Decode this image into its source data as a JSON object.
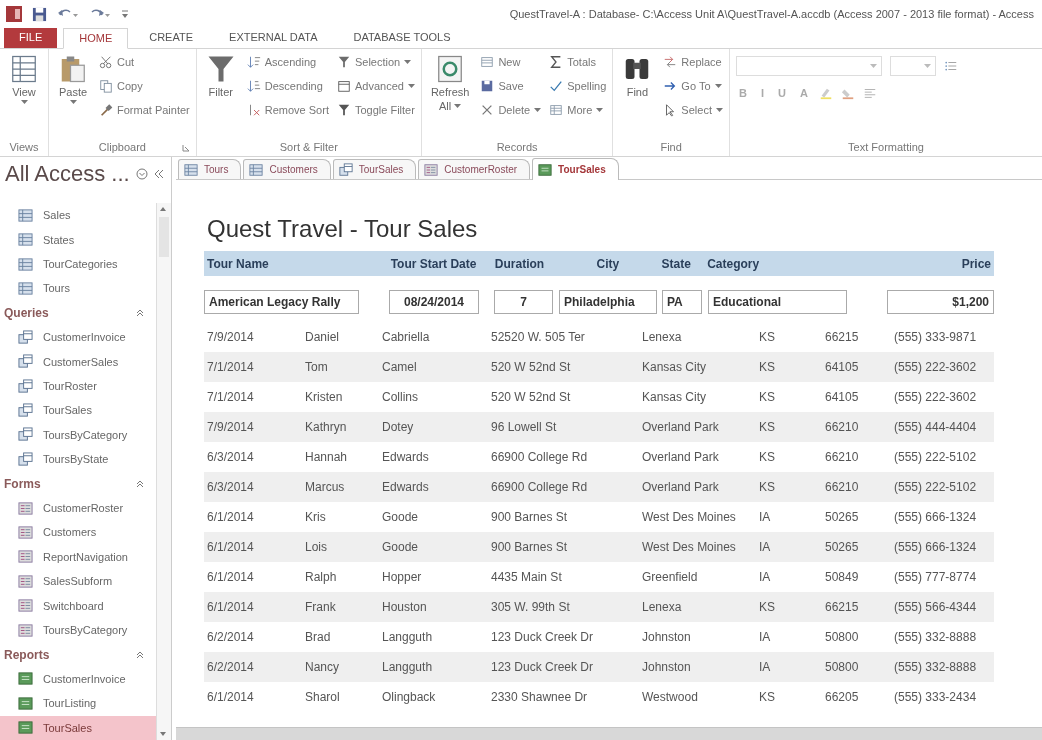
{
  "title_bar": {
    "title": "QuestTravel-A : Database- C:\\Access Unit A\\QuestTravel-A.accdb (Access 2007 - 2013 file format) - Access"
  },
  "ribbon": {
    "tabs": [
      {
        "label": "FILE",
        "kind": "file",
        "selected": false
      },
      {
        "label": "HOME",
        "kind": "tab",
        "selected": true
      },
      {
        "label": "CREATE",
        "kind": "tab",
        "selected": false
      },
      {
        "label": "EXTERNAL DATA",
        "kind": "tab",
        "selected": false
      },
      {
        "label": "DATABASE TOOLS",
        "kind": "tab",
        "selected": false
      }
    ],
    "groups": [
      {
        "label": "Views",
        "kind": "columns",
        "columns": [
          [
            {
              "label": "View",
              "kind": "large",
              "dropdown": true
            }
          ]
        ]
      },
      {
        "label": "Clipboard",
        "kind": "columns",
        "launcher": true,
        "columns": [
          [
            {
              "label": "Paste",
              "kind": "large",
              "dropdown": true
            }
          ],
          [
            {
              "label": "Cut",
              "kind": "small",
              "dropdown": false
            },
            {
              "label": "Copy",
              "kind": "small",
              "dropdown": false
            },
            {
              "label": "Format Painter",
              "kind": "small",
              "dropdown": false
            }
          ]
        ]
      },
      {
        "label": "Sort & Filter",
        "kind": "columns",
        "columns": [
          [
            {
              "label": "Filter",
              "kind": "large",
              "dropdown": false
            }
          ],
          [
            {
              "label": "Ascending",
              "kind": "small",
              "dropdown": false
            },
            {
              "label": "Descending",
              "kind": "small",
              "dropdown": false
            },
            {
              "label": "Remove Sort",
              "kind": "small",
              "dropdown": false
            }
          ],
          [
            {
              "label": "Selection",
              "kind": "small",
              "dropdown": true
            },
            {
              "label": "Advanced",
              "kind": "small",
              "dropdown": true
            },
            {
              "label": "Toggle Filter",
              "kind": "small",
              "dropdown": false
            }
          ]
        ]
      },
      {
        "label": "Records",
        "kind": "columns",
        "columns": [
          [
            {
              "label": "Refresh All",
              "kind": "large",
              "dropdown": true
            }
          ],
          [
            {
              "label": "New",
              "kind": "small",
              "dropdown": false
            },
            {
              "label": "Save",
              "kind": "small",
              "dropdown": false
            },
            {
              "label": "Delete",
              "kind": "small",
              "dropdown": true
            }
          ],
          [
            {
              "label": "Totals",
              "kind": "small",
              "dropdown": false
            },
            {
              "label": "Spelling",
              "kind": "small",
              "dropdown": false
            },
            {
              "label": "More",
              "kind": "small",
              "dropdown": true
            }
          ]
        ]
      },
      {
        "label": "Find",
        "kind": "columns",
        "columns": [
          [
            {
              "label": "Find",
              "kind": "large",
              "dropdown": false
            }
          ],
          [
            {
              "label": "Replace",
              "kind": "small",
              "dropdown": false
            },
            {
              "label": "Go To",
              "kind": "small",
              "dropdown": true
            },
            {
              "label": "Select",
              "kind": "small",
              "dropdown": true
            }
          ]
        ]
      },
      {
        "label": "Text Formatting",
        "kind": "rows",
        "rows": [
          [
            {
              "kind": "combo"
            },
            {
              "kind": "combo"
            },
            {
              "kind": "icon"
            }
          ],
          [
            {
              "kind": "letter",
              "label": "B"
            },
            {
              "kind": "letter",
              "label": "I"
            },
            {
              "kind": "letter",
              "label": "U"
            },
            {
              "kind": "letter",
              "label": "A"
            },
            {
              "kind": "icon"
            },
            {
              "kind": "icon"
            },
            {
              "kind": "icon"
            }
          ]
        ]
      }
    ]
  },
  "nav_pane": {
    "title": "All Access ...",
    "sections": [
      {
        "kind": "table",
        "items": [
          {
            "label": "Sales",
            "selected": false
          },
          {
            "label": "States",
            "selected": false
          },
          {
            "label": "TourCategories",
            "selected": false
          },
          {
            "label": "Tours",
            "selected": false
          }
        ]
      },
      {
        "kind": "query",
        "header": "Queries",
        "expanded": true,
        "items": [
          {
            "label": "CustomerInvoice",
            "selected": false
          },
          {
            "label": "CustomerSales",
            "selected": false
          },
          {
            "label": "TourRoster",
            "selected": false
          },
          {
            "label": "TourSales",
            "selected": false
          },
          {
            "label": "ToursByCategory",
            "selected": false
          },
          {
            "label": "ToursByState",
            "selected": false
          }
        ]
      },
      {
        "kind": "form",
        "header": "Forms",
        "expanded": true,
        "items": [
          {
            "label": "CustomerRoster",
            "selected": false
          },
          {
            "label": "Customers",
            "selected": false
          },
          {
            "label": "ReportNavigation",
            "selected": false
          },
          {
            "label": "SalesSubform",
            "selected": false
          },
          {
            "label": "Switchboard",
            "selected": false
          },
          {
            "label": "ToursByCategory",
            "selected": false
          }
        ]
      },
      {
        "kind": "report",
        "header": "Reports",
        "expanded": true,
        "items": [
          {
            "label": "CustomerInvoice",
            "selected": false
          },
          {
            "label": "TourListing",
            "selected": false
          },
          {
            "label": "TourSales",
            "selected": true
          }
        ]
      }
    ]
  },
  "document_tabs": [
    {
      "label": "Tours",
      "kind": "table",
      "selected": false
    },
    {
      "label": "Customers",
      "kind": "table",
      "selected": false
    },
    {
      "label": "TourSales",
      "kind": "query",
      "selected": false
    },
    {
      "label": "CustomerRoster",
      "kind": "form",
      "selected": false
    },
    {
      "label": "TourSales",
      "kind": "report",
      "selected": true
    }
  ],
  "report": {
    "title": "Quest Travel - Tour Sales",
    "tour_header": {
      "labels": [
        "Tour Name",
        "Tour Start Date",
        "Duration",
        "City",
        "State",
        "Category",
        "Price"
      ],
      "values": [
        "American Legacy Rally",
        "08/24/2014",
        "7",
        "Philadelphia",
        "PA",
        "Educational",
        "$1,200"
      ]
    },
    "detail_lines": [
      [
        "7/9/2014",
        "Daniel",
        "Cabriella",
        "52520 W. 505 Ter",
        "Lenexa",
        "KS",
        "66215",
        "(555) 333-9871"
      ],
      [
        "7/1/2014",
        "Tom",
        "Camel",
        "520 W 52nd St",
        "Kansas City",
        "KS",
        "64105",
        "(555) 222-3602"
      ],
      [
        "7/1/2014",
        "Kristen",
        "Collins",
        "520 W 52nd St",
        "Kansas City",
        "KS",
        "64105",
        "(555) 222-3602"
      ],
      [
        "7/9/2014",
        "Kathryn",
        "Dotey",
        "96 Lowell St",
        "Overland Park",
        "KS",
        "66210",
        "(555) 444-4404"
      ],
      [
        "6/3/2014",
        "Hannah",
        "Edwards",
        "66900 College Rd",
        "Overland Park",
        "KS",
        "66210",
        "(555) 222-5102"
      ],
      [
        "6/3/2014",
        "Marcus",
        "Edwards",
        "66900 College Rd",
        "Overland Park",
        "KS",
        "66210",
        "(555) 222-5102"
      ],
      [
        "6/1/2014",
        "Kris",
        "Goode",
        "900 Barnes St",
        "West Des Moines",
        "IA",
        "50265",
        "(555) 666-1324"
      ],
      [
        "6/1/2014",
        "Lois",
        "Goode",
        "900 Barnes St",
        "West Des Moines",
        "IA",
        "50265",
        "(555) 666-1324"
      ],
      [
        "6/1/2014",
        "Ralph",
        "Hopper",
        "4435 Main St",
        "Greenfield",
        "IA",
        "50849",
        "(555) 777-8774"
      ],
      [
        "6/1/2014",
        "Frank",
        "Houston",
        "305 W. 99th St",
        "Lenexa",
        "KS",
        "66215",
        "(555) 566-4344"
      ],
      [
        "6/2/2014",
        "Brad",
        "Langguth",
        "123 Duck Creek Dr",
        "Johnston",
        "IA",
        "50800",
        "(555) 332-8888"
      ],
      [
        "6/2/2014",
        "Nancy",
        "Langguth",
        "123 Duck Creek Dr",
        "Johnston",
        "IA",
        "50800",
        "(555) 332-8888"
      ],
      [
        "6/1/2014",
        "Sharol",
        "Olingback",
        "2330 Shawnee Dr",
        "Westwood",
        "KS",
        "66205",
        "(555) 333-2434"
      ]
    ]
  }
}
